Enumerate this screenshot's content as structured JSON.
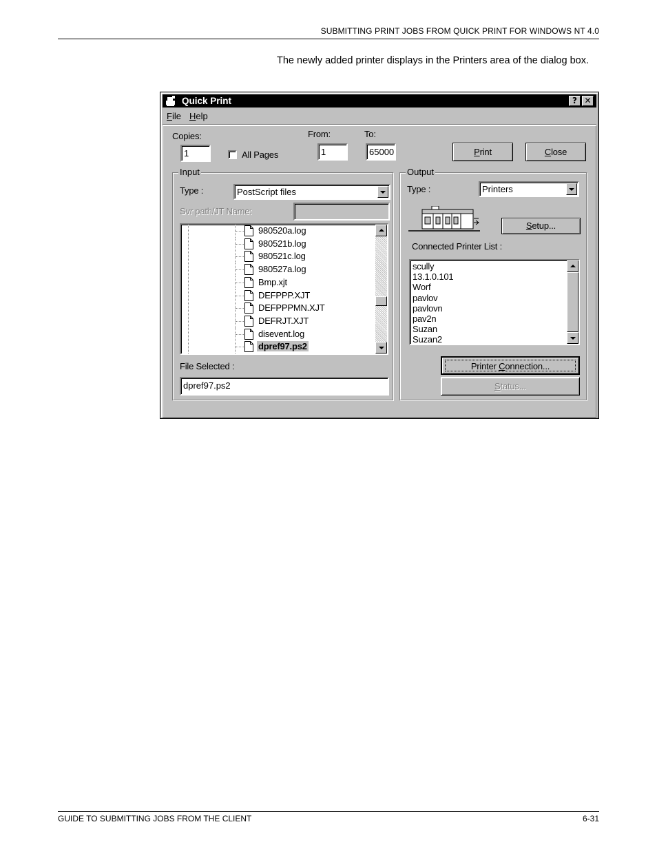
{
  "page": {
    "header": "SUBMITTING PRINT JOBS FROM QUICK PRINT FOR WINDOWS NT 4.0",
    "body_text": "The newly added printer displays in the Printers area of the dialog box.",
    "footer_left": "GUIDE TO SUBMITTING JOBS FROM THE CLIENT",
    "footer_right": "6-31"
  },
  "dialog": {
    "title": "Quick Print",
    "help_glyph": "?",
    "close_glyph": "✕",
    "menu": [
      {
        "mnemonic": "F",
        "rest": "ile"
      },
      {
        "mnemonic": "H",
        "rest": "elp"
      }
    ],
    "copies": {
      "label": "Copies:",
      "value": "1"
    },
    "all_pages": {
      "label": "All Pages",
      "checked": false
    },
    "from": {
      "label": "From:",
      "value": "1"
    },
    "to": {
      "label": "To:",
      "value": "65000"
    },
    "print_button": {
      "mnemonic": "P",
      "rest": "rint"
    },
    "close_button": {
      "mnemonic": "C",
      "rest": "lose"
    },
    "input": {
      "group_label": "Input",
      "type_label": "Type :",
      "type_value": "PostScript files",
      "svr_label": "Svr path/JT Name:",
      "svr_value": "",
      "files": [
        "980520a.log",
        "980521b.log",
        "980521c.log",
        "980527a.log",
        "Bmp.xjt",
        "DEFPPP.XJT",
        "DEFPPPMN.XJT",
        "DEFRJT.XJT",
        "disevent.log",
        "dpref97.ps2"
      ],
      "selected_index": 9,
      "file_selected_label": "File Selected :",
      "file_selected_value": "dpref97.ps2"
    },
    "output": {
      "group_label": "Output",
      "type_label": "Type :",
      "type_value": "Printers",
      "setup_button": {
        "mnemonic": "S",
        "rest": "etup..."
      },
      "connected_label": "Connected Printer List :",
      "printers": [
        "scully",
        "13.1.0.101",
        "Worf",
        "pavlov",
        "pavlovn",
        "pav2n",
        "Suzan",
        "Suzan2"
      ],
      "printer_connection_button": {
        "pre": "Printer ",
        "mnemonic": "C",
        "rest": "onnection..."
      },
      "status_button": {
        "mnemonic": "S",
        "rest": "tatus..."
      }
    }
  }
}
